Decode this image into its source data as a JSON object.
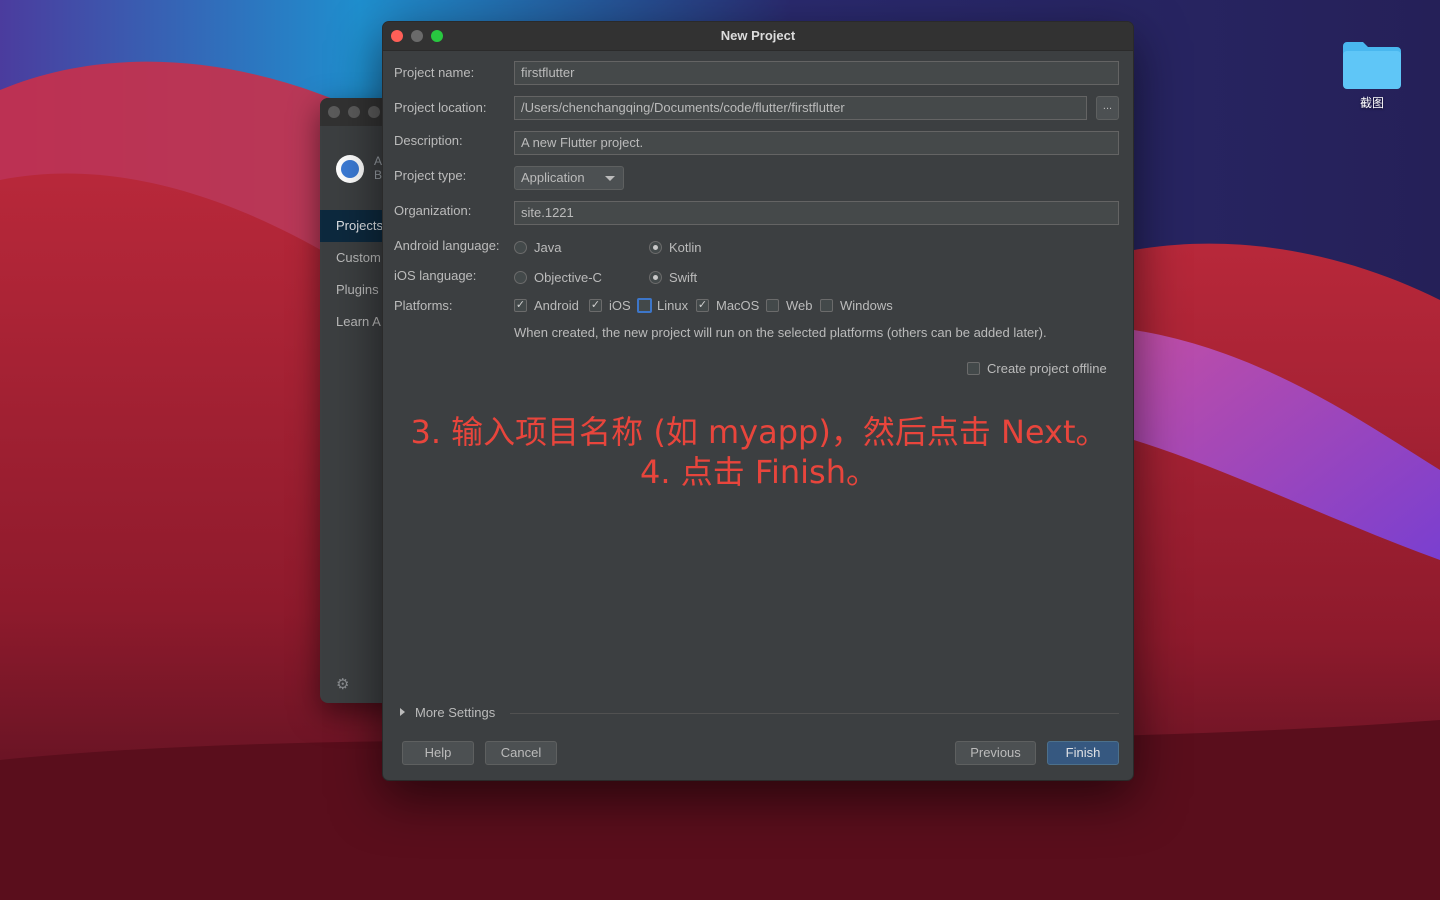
{
  "dialog": {
    "title": "New Project"
  },
  "form": {
    "project_name_label": "Project name:",
    "project_name_value": "firstflutter",
    "project_location_label": "Project location:",
    "project_location_value": "/Users/chenchangqing/Documents/code/flutter/firstflutter",
    "browse_label": "...",
    "description_label": "Description:",
    "description_value": "A new Flutter project.",
    "project_type_label": "Project type:",
    "project_type_value": "Application",
    "organization_label": "Organization:",
    "organization_value": "site.1221",
    "android_language_label": "Android language:",
    "android_language_options": [
      {
        "label": "Java",
        "selected": false
      },
      {
        "label": "Kotlin",
        "selected": true
      }
    ],
    "ios_language_label": "iOS language:",
    "ios_language_options": [
      {
        "label": "Objective-C",
        "selected": false
      },
      {
        "label": "Swift",
        "selected": true
      }
    ],
    "platforms_label": "Platforms:",
    "platforms": [
      {
        "label": "Android",
        "checked": true
      },
      {
        "label": "iOS",
        "checked": true
      },
      {
        "label": "Linux",
        "checked": false
      },
      {
        "label": "MacOS",
        "checked": true
      },
      {
        "label": "Web",
        "checked": false
      },
      {
        "label": "Windows",
        "checked": false
      }
    ],
    "platforms_note": "When created, the new project will run on the selected platforms (others can be added later).",
    "offline_label": "Create project offline",
    "offline_checked": false
  },
  "annotation": {
    "line1": "3. 输入项目名称 (如 myapp)，然后点击 Next。",
    "line2": "4. 点击 Finish。",
    "color": "#e8453c"
  },
  "more_settings_label": "More Settings",
  "buttons": {
    "help": "Help",
    "cancel": "Cancel",
    "previous": "Previous",
    "finish": "Finish"
  },
  "background_window": {
    "nav_items": [
      "Projects",
      "Custom",
      "Plugins",
      "Learn A"
    ],
    "app_letters": [
      "A",
      "B"
    ],
    "icons": [
      "app-logo-icon",
      "gear-icon"
    ]
  },
  "desktop": {
    "folder_label": "截图"
  }
}
